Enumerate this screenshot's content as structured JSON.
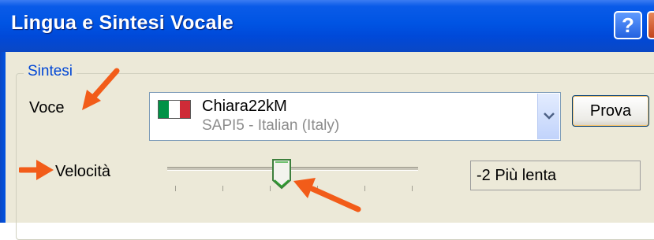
{
  "window": {
    "title": "Lingua e Sintesi Vocale",
    "help_label": "?"
  },
  "group": {
    "legend": "Sintesi"
  },
  "voice": {
    "label": "Voce",
    "selected_name": "Chiara22kM",
    "selected_engine": "SAPI5 - Italian (Italy)",
    "flag_colors": [
      "#009246",
      "#FFFFFF",
      "#CE2B37"
    ],
    "test_button": "Prova"
  },
  "speed": {
    "label": "Velocità",
    "value_text": "-2 Più lenta",
    "slider_position": 0.45,
    "tick_count": 6
  },
  "annotations": {
    "arrow_color": "#F25C19",
    "count": 3
  },
  "colors": {
    "title_bar": "#0054E3",
    "dialog_bg": "#ECE9D8",
    "group_legend": "#0046D5"
  }
}
